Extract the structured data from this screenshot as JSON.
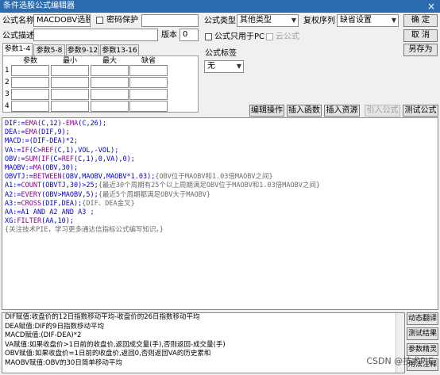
{
  "window": {
    "title": "条件选股公式编辑器",
    "close_glyph": "×"
  },
  "form": {
    "name_label": "公式名称",
    "name_value": "MACDOBV选股",
    "password_label": "密码保护",
    "desc_label": "公式描述",
    "desc_value": "",
    "version_label": "版本",
    "version_value": "0",
    "type_label": "公式类型",
    "type_value": "其他类型",
    "order_label": "复权序列",
    "order_value": "缺省设置",
    "pc_only_label": "公式只用于PC",
    "cloud_label": "云公式",
    "tag_label": "公式标签",
    "tag_value": "无"
  },
  "buttons": {
    "ok": "确  定",
    "cancel": "取  消",
    "save_as": "另存为",
    "edit_ops": "编辑操作",
    "insert_func": "插入函数",
    "insert_res": "插入资源",
    "import_formula": "引入公式",
    "test_formula": "测试公式"
  },
  "param_tabs": [
    "参数1-4",
    "参数5-8",
    "参数9-12",
    "参数13-16"
  ],
  "param_headers": [
    "参数",
    "最小",
    "最大",
    "缺省"
  ],
  "param_rows": [
    "1",
    "2",
    "3",
    "4"
  ],
  "code_lines": [
    [
      {
        "t": "DIF:=",
        "c": "kw"
      },
      {
        "t": "EMA",
        "c": "fn"
      },
      {
        "t": "(",
        "c": "kw"
      },
      {
        "t": "C",
        "c": "kw"
      },
      {
        "t": ",",
        "c": "kw"
      },
      {
        "t": "12",
        "c": "num"
      },
      {
        "t": ")-",
        "c": "kw"
      },
      {
        "t": "EMA",
        "c": "fn"
      },
      {
        "t": "(",
        "c": "kw"
      },
      {
        "t": "C",
        "c": "kw"
      },
      {
        "t": ",",
        "c": "kw"
      },
      {
        "t": "26",
        "c": "num"
      },
      {
        "t": ");",
        "c": "kw"
      }
    ],
    [
      {
        "t": "DEA:=",
        "c": "kw"
      },
      {
        "t": "EMA",
        "c": "fn"
      },
      {
        "t": "(DIF,",
        "c": "kw"
      },
      {
        "t": "9",
        "c": "num"
      },
      {
        "t": ");",
        "c": "kw"
      }
    ],
    [
      {
        "t": "MACD:=(DIF-DEA)*",
        "c": "kw"
      },
      {
        "t": "2",
        "c": "num"
      },
      {
        "t": ";",
        "c": "kw"
      }
    ],
    [
      {
        "t": "VA:=",
        "c": "kw"
      },
      {
        "t": "IF",
        "c": "fn"
      },
      {
        "t": "(C>",
        "c": "kw"
      },
      {
        "t": "REF",
        "c": "fn"
      },
      {
        "t": "(C,",
        "c": "kw"
      },
      {
        "t": "1",
        "c": "num"
      },
      {
        "t": "),",
        "c": "kw"
      },
      {
        "t": "VOL",
        "c": "kw"
      },
      {
        "t": ",-",
        "c": "kw"
      },
      {
        "t": "VOL",
        "c": "kw"
      },
      {
        "t": ");",
        "c": "kw"
      }
    ],
    [
      {
        "t": "OBV:=",
        "c": "kw"
      },
      {
        "t": "SUM",
        "c": "fn"
      },
      {
        "t": "(",
        "c": "kw"
      },
      {
        "t": "IF",
        "c": "fn"
      },
      {
        "t": "(C=",
        "c": "kw"
      },
      {
        "t": "REF",
        "c": "fn"
      },
      {
        "t": "(C,",
        "c": "kw"
      },
      {
        "t": "1",
        "c": "num"
      },
      {
        "t": "),",
        "c": "kw"
      },
      {
        "t": "0",
        "c": "num"
      },
      {
        "t": ",VA),",
        "c": "kw"
      },
      {
        "t": "0",
        "c": "num"
      },
      {
        "t": ");",
        "c": "kw"
      }
    ],
    [
      {
        "t": "MAOBV:=",
        "c": "kw"
      },
      {
        "t": "MA",
        "c": "fn"
      },
      {
        "t": "(OBV,",
        "c": "kw"
      },
      {
        "t": "30",
        "c": "num"
      },
      {
        "t": ");",
        "c": "kw"
      }
    ],
    [
      {
        "t": "OBVTJ:=",
        "c": "kw"
      },
      {
        "t": "BETWEEN",
        "c": "fn"
      },
      {
        "t": "(OBV,MAOBV,MAOBV*",
        "c": "kw"
      },
      {
        "t": "1.03",
        "c": "num"
      },
      {
        "t": ");",
        "c": "kw"
      },
      {
        "t": "{OBV位于MAOBV和1.03倍MAOBV之间}",
        "c": "cm"
      }
    ],
    [
      {
        "t": "A1:=",
        "c": "kw"
      },
      {
        "t": "COUNT",
        "c": "fn"
      },
      {
        "t": "(OBVTJ,",
        "c": "kw"
      },
      {
        "t": "30",
        "c": "num"
      },
      {
        "t": ")>",
        "c": "kw"
      },
      {
        "t": "25",
        "c": "num"
      },
      {
        "t": ";",
        "c": "kw"
      },
      {
        "t": "{最近30个周期有25个以上周期满足OBV位于MAOBV和1.03倍MAOBV之间}",
        "c": "cm"
      }
    ],
    [
      {
        "t": "A2:=",
        "c": "kw"
      },
      {
        "t": "EVERY",
        "c": "fn"
      },
      {
        "t": "(OBV>MAOBV,",
        "c": "kw"
      },
      {
        "t": "5",
        "c": "num"
      },
      {
        "t": ");",
        "c": "kw"
      },
      {
        "t": "{最近5个周期都满足OBV大于MAOBV}",
        "c": "cm"
      }
    ],
    [
      {
        "t": "A3:=",
        "c": "kw"
      },
      {
        "t": "CROSS",
        "c": "fn"
      },
      {
        "t": "(DIF,DEA);",
        "c": "kw"
      },
      {
        "t": "{DIF、DEA金叉}",
        "c": "cm"
      }
    ],
    [
      {
        "t": "AA:=A1 AND A2 AND A3 ;",
        "c": "kw"
      }
    ],
    [
      {
        "t": "XG:",
        "c": "kw"
      },
      {
        "t": "FILTER",
        "c": "fn"
      },
      {
        "t": "(AA,",
        "c": "kw"
      },
      {
        "t": "10",
        "c": "num"
      },
      {
        "t": ");",
        "c": "kw"
      }
    ],
    [
      {
        "t": "{关注技术PIE，学习更多通达信指标公式编写知识。}",
        "c": "cm"
      }
    ]
  ],
  "help_lines": [
    "DIF赋值:收盘价的12日指数移动平均-收盘价的26日指数移动平均",
    "DEA赋值:DIF的9日指数移动平均",
    "MACD赋值:(DIF-DEA)*2",
    "VA赋值:如果收盘价>1日前的收盘价,返回成交量(手),否则返回-成交量(手)",
    "OBV赋值:如果收盘价=1日前的收盘价,返回0,否则返回VA的历史累和",
    "MAOBV赋值:OBV的30日简单移动平均"
  ],
  "side_buttons": [
    "动态翻译",
    "测试结果",
    "参数精灵",
    "用法注释"
  ],
  "watermark": "CSDN @技术PIE",
  "colors": {
    "titlebar": "#2b6cb0",
    "keyword": "#0000cc",
    "function": "#8b008b",
    "comment": "#6b6b6b"
  }
}
